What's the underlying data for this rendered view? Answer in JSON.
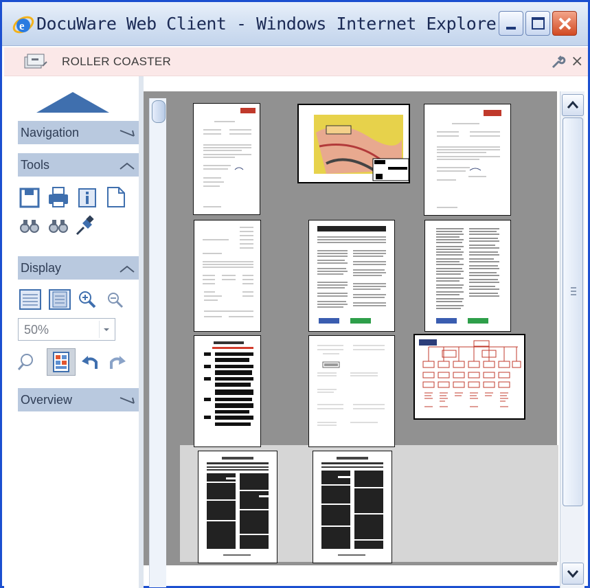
{
  "window": {
    "title": "DocuWare Web Client - Windows Internet Explorer",
    "accent_color": "#1c4fd0",
    "buttons": [
      "minimize-icon",
      "maximize-icon",
      "close-icon"
    ]
  },
  "pane": {
    "title": "ROLLER COASTER",
    "icons": [
      "file-cabinet-icon",
      "wrench-icon",
      "close-icon"
    ]
  },
  "sidebar": {
    "sections": {
      "navigation": "Navigation",
      "tools": "Tools",
      "display": "Display",
      "overview": "Overview"
    },
    "tool_icons": [
      "save-icon",
      "print-icon",
      "info-icon",
      "document-icon",
      "find-icon",
      "find-next-icon",
      "pin-icon"
    ],
    "display_icons": [
      "single-page-icon",
      "two-page-icon",
      "zoom-in-icon",
      "zoom-out-icon",
      "magnifier-icon",
      "thumbnail-view-icon",
      "undo-icon",
      "redo-icon"
    ],
    "zoom_value": "50%"
  },
  "viewer": {
    "background_color": "#919191",
    "pages": [
      {
        "kind": "letter"
      },
      {
        "kind": "map"
      },
      {
        "kind": "letter"
      },
      {
        "kind": "form"
      },
      {
        "kind": "text-columns"
      },
      {
        "kind": "text-columns"
      },
      {
        "kind": "table"
      },
      {
        "kind": "blank-form"
      },
      {
        "kind": "org-chart"
      },
      {
        "kind": "article"
      },
      {
        "kind": "article"
      }
    ]
  }
}
